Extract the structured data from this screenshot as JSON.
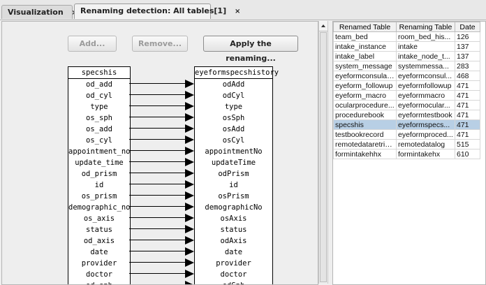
{
  "tabs": [
    {
      "label": "Visualization",
      "close": "×"
    },
    {
      "label": "Renaming detection: All tables[1]",
      "close": "×"
    }
  ],
  "toolbar": {
    "add_label": "Add...",
    "remove_label": "Remove...",
    "apply_label": "Apply the renaming..."
  },
  "mapping": {
    "source_table": "specshis",
    "target_table": "eyeformspecshistory",
    "source_columns": [
      "od_add",
      "od_cyl",
      "type",
      "os_sph",
      "os_add",
      "os_cyl",
      "appointment_no",
      "update_time",
      "od_prism",
      "id",
      "os_prism",
      "demographic_no",
      "os_axis",
      "status",
      "od_axis",
      "date",
      "provider",
      "doctor",
      "od_sph"
    ],
    "target_columns": [
      "odAdd",
      "odCyl",
      "type",
      "osSph",
      "osAdd",
      "osCyl",
      "appointmentNo",
      "updateTime",
      "odPrism",
      "id",
      "osPrism",
      "demographicNo",
      "osAxis",
      "status",
      "odAxis",
      "date",
      "provider",
      "doctor",
      "odSph"
    ]
  },
  "renamed_table": {
    "headers": [
      "Renamed Table",
      "Renaming Table",
      "Date"
    ],
    "rows": [
      [
        "team_bed",
        "room_bed_his...",
        "126"
      ],
      [
        "intake_instance",
        "intake",
        "137"
      ],
      [
        "intake_label",
        "intake_node_t...",
        "137"
      ],
      [
        "system_message",
        "systemmessa...",
        "283"
      ],
      [
        "eyeformconsulat...",
        "eyeformconsul...",
        "468"
      ],
      [
        "eyeform_followup",
        "eyeformfollowup",
        "471"
      ],
      [
        "eyeform_macro",
        "eyeformmacro",
        "471"
      ],
      [
        "ocularprocedure...",
        "eyeformocular...",
        "471"
      ],
      [
        "procedurebook",
        "eyeformtestbook",
        "471"
      ],
      [
        "specshis",
        "eyeformspecs...",
        "471"
      ],
      [
        "testbookrecord",
        "eyeformproced...",
        "471"
      ],
      [
        "remotedataretrie...",
        "remotedatalog",
        "515"
      ],
      [
        "formintakehhx",
        "formintakehx",
        "610"
      ]
    ],
    "selected_row": 9
  },
  "colors": {
    "selection": "#b8cfe5",
    "background": "#eeeeee"
  }
}
